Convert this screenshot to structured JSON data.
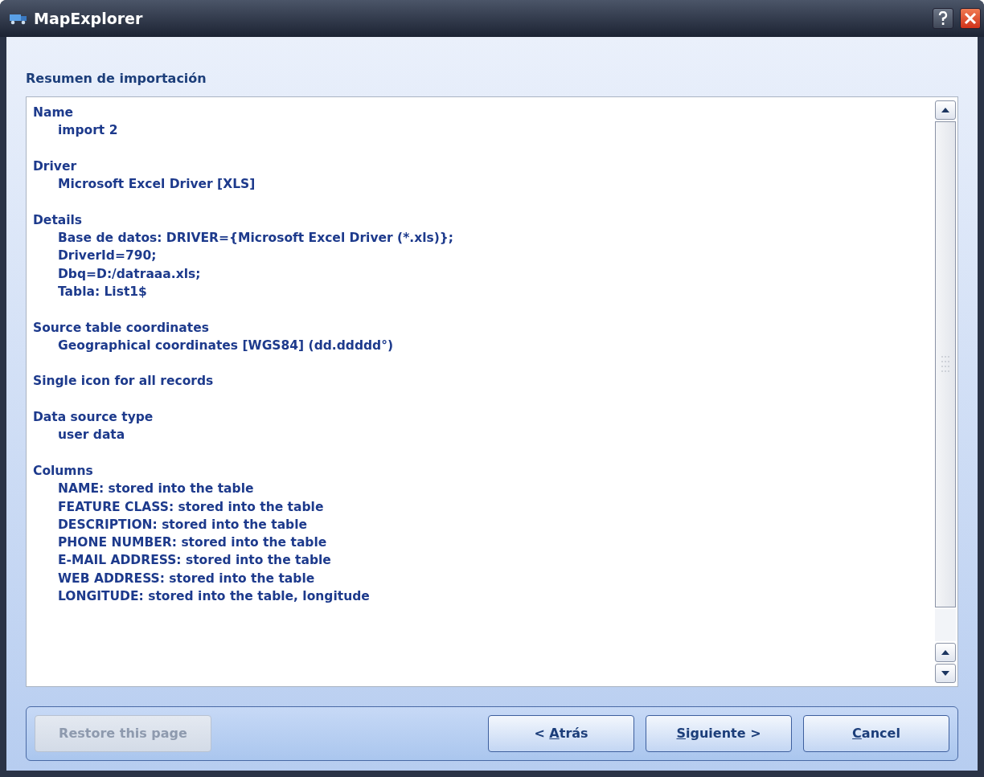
{
  "window": {
    "title": "MapExplorer"
  },
  "heading": "Resumen de importación",
  "sections": [
    {
      "title": "Name",
      "lines": [
        "import 2"
      ]
    },
    {
      "title": "Driver",
      "lines": [
        "Microsoft Excel Driver [XLS]"
      ]
    },
    {
      "title": "Details",
      "lines": [
        "Base de datos: DRIVER={Microsoft Excel Driver (*.xls)};",
        "DriverId=790;",
        "Dbq=D:/datraaa.xls;",
        "Tabla: List1$"
      ]
    },
    {
      "title": "Source table coordinates",
      "lines": [
        "Geographical coordinates [WGS84] (dd.ddddd°)"
      ]
    },
    {
      "title": "Single icon for all records"
    },
    {
      "title": "Data source type",
      "lines": [
        "user data"
      ]
    },
    {
      "title": "Columns",
      "lines": [
        "NAME: stored into the table",
        "FEATURE CLASS: stored into the table",
        "DESCRIPTION: stored into the table",
        "PHONE NUMBER: stored into the table",
        "E-MAIL ADDRESS: stored into the table",
        "WEB ADDRESS: stored into the table",
        "LONGITUDE: stored into the table, longitude"
      ]
    }
  ],
  "buttons": [
    {
      "label": "Restore this page",
      "disabled": true
    },
    {
      "label_before": "< ",
      "access_key": "A",
      "label_after": "trás",
      "disabled": false
    },
    {
      "access_key": "S",
      "label_after": "iguiente >",
      "disabled": false
    },
    {
      "access_key": "C",
      "label_after": "ancel",
      "disabled": false
    }
  ]
}
